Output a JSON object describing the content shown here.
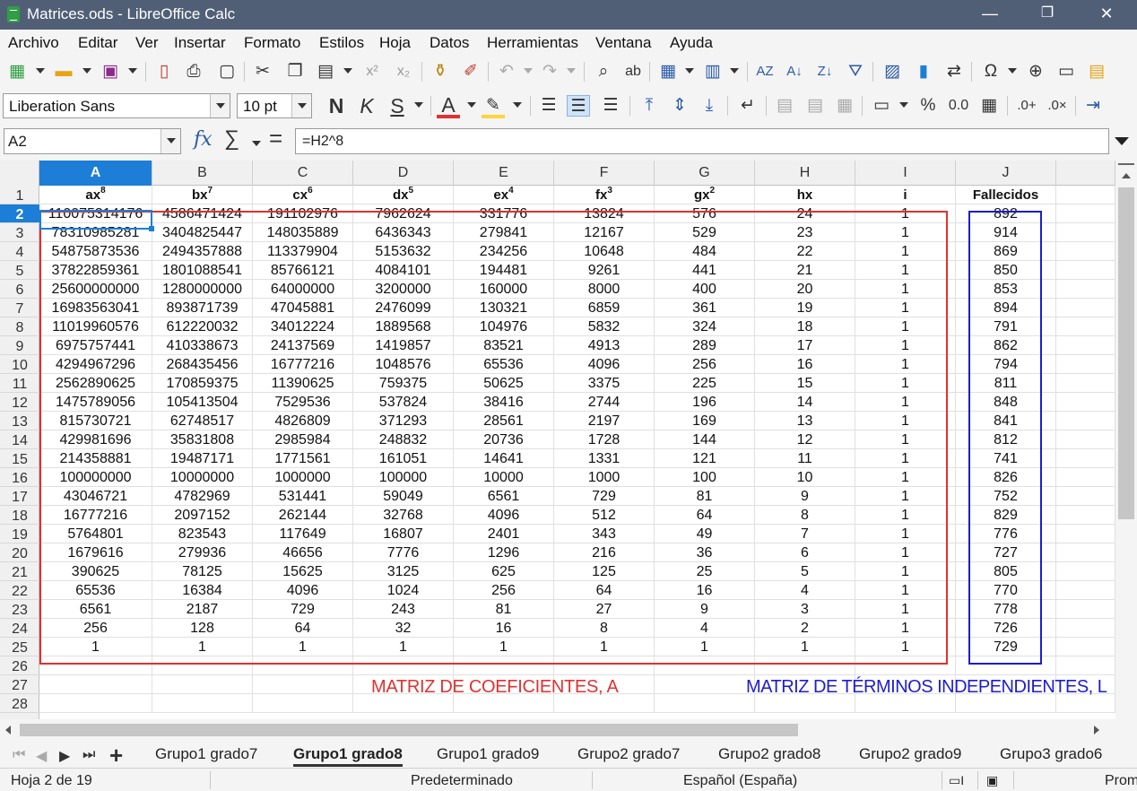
{
  "window": {
    "title": "Matrices.ods - LibreOffice Calc",
    "minimize": "—",
    "maximize": "❐",
    "close": "✕"
  },
  "menu": [
    "Archivo",
    "Editar",
    "Ver",
    "Insertar",
    "Formato",
    "Estilos",
    "Hoja",
    "Datos",
    "Herramientas",
    "Ventana",
    "Ayuda"
  ],
  "format_toolbar": {
    "font_name": "Liberation Sans",
    "font_size": "10 pt",
    "bold": "N",
    "italic": "K",
    "underline": "S",
    "font_color": "A",
    "percent": "%",
    "decimal": "0.0"
  },
  "formula_bar": {
    "name_box": "A2",
    "fx": "fx",
    "sigma": "∑",
    "equals": "=",
    "formula": "=H2^8"
  },
  "grid": {
    "columns": [
      "A",
      "B",
      "C",
      "D",
      "E",
      "F",
      "G",
      "H",
      "I",
      "J"
    ],
    "active_column": "A",
    "active_row": 2,
    "row_numbers": [
      1,
      2,
      3,
      4,
      5,
      6,
      7,
      8,
      9,
      10,
      11,
      12,
      13,
      14,
      15,
      16,
      17,
      18,
      19,
      20,
      21,
      22,
      23,
      24,
      25,
      26,
      27,
      28
    ],
    "headers": {
      "A": {
        "base": "ax",
        "sup": "8"
      },
      "B": {
        "base": "bx",
        "sup": "7"
      },
      "C": {
        "base": "cx",
        "sup": "6"
      },
      "D": {
        "base": "dx",
        "sup": "5"
      },
      "E": {
        "base": "ex",
        "sup": "4"
      },
      "F": {
        "base": "fx",
        "sup": "3"
      },
      "G": {
        "base": "gx",
        "sup": "2"
      },
      "H": {
        "base": "hx",
        "sup": ""
      },
      "I": {
        "base": "i",
        "sup": ""
      },
      "J": {
        "base": "Fallecidos",
        "sup": ""
      }
    },
    "rows": [
      [
        "110075314176",
        "4586471424",
        "191102976",
        "7962624",
        "331776",
        "13824",
        "576",
        "24",
        "1",
        "892"
      ],
      [
        "78310985281",
        "3404825447",
        "148035889",
        "6436343",
        "279841",
        "12167",
        "529",
        "23",
        "1",
        "914"
      ],
      [
        "54875873536",
        "2494357888",
        "113379904",
        "5153632",
        "234256",
        "10648",
        "484",
        "22",
        "1",
        "869"
      ],
      [
        "37822859361",
        "1801088541",
        "85766121",
        "4084101",
        "194481",
        "9261",
        "441",
        "21",
        "1",
        "850"
      ],
      [
        "25600000000",
        "1280000000",
        "64000000",
        "3200000",
        "160000",
        "8000",
        "400",
        "20",
        "1",
        "853"
      ],
      [
        "16983563041",
        "893871739",
        "47045881",
        "2476099",
        "130321",
        "6859",
        "361",
        "19",
        "1",
        "894"
      ],
      [
        "11019960576",
        "612220032",
        "34012224",
        "1889568",
        "104976",
        "5832",
        "324",
        "18",
        "1",
        "791"
      ],
      [
        "6975757441",
        "410338673",
        "24137569",
        "1419857",
        "83521",
        "4913",
        "289",
        "17",
        "1",
        "862"
      ],
      [
        "4294967296",
        "268435456",
        "16777216",
        "1048576",
        "65536",
        "4096",
        "256",
        "16",
        "1",
        "794"
      ],
      [
        "2562890625",
        "170859375",
        "11390625",
        "759375",
        "50625",
        "3375",
        "225",
        "15",
        "1",
        "811"
      ],
      [
        "1475789056",
        "105413504",
        "7529536",
        "537824",
        "38416",
        "2744",
        "196",
        "14",
        "1",
        "848"
      ],
      [
        "815730721",
        "62748517",
        "4826809",
        "371293",
        "28561",
        "2197",
        "169",
        "13",
        "1",
        "841"
      ],
      [
        "429981696",
        "35831808",
        "2985984",
        "248832",
        "20736",
        "1728",
        "144",
        "12",
        "1",
        "812"
      ],
      [
        "214358881",
        "19487171",
        "1771561",
        "161051",
        "14641",
        "1331",
        "121",
        "11",
        "1",
        "741"
      ],
      [
        "100000000",
        "10000000",
        "1000000",
        "100000",
        "10000",
        "1000",
        "100",
        "10",
        "1",
        "826"
      ],
      [
        "43046721",
        "4782969",
        "531441",
        "59049",
        "6561",
        "729",
        "81",
        "9",
        "1",
        "752"
      ],
      [
        "16777216",
        "2097152",
        "262144",
        "32768",
        "4096",
        "512",
        "64",
        "8",
        "1",
        "829"
      ],
      [
        "5764801",
        "823543",
        "117649",
        "16807",
        "2401",
        "343",
        "49",
        "7",
        "1",
        "776"
      ],
      [
        "1679616",
        "279936",
        "46656",
        "7776",
        "1296",
        "216",
        "36",
        "6",
        "1",
        "727"
      ],
      [
        "390625",
        "78125",
        "15625",
        "3125",
        "625",
        "125",
        "25",
        "5",
        "1",
        "805"
      ],
      [
        "65536",
        "16384",
        "4096",
        "1024",
        "256",
        "64",
        "16",
        "4",
        "1",
        "770"
      ],
      [
        "6561",
        "2187",
        "729",
        "243",
        "81",
        "27",
        "9",
        "3",
        "1",
        "778"
      ],
      [
        "256",
        "128",
        "64",
        "32",
        "16",
        "8",
        "4",
        "2",
        "1",
        "726"
      ],
      [
        "1",
        "1",
        "1",
        "1",
        "1",
        "1",
        "1",
        "1",
        "1",
        "729"
      ]
    ],
    "annotation_left": "MATRIZ DE COEFICIENTES, A",
    "annotation_right": "MATRIZ DE TÉRMINOS INDEPENDIENTES, L",
    "colors": {
      "selection": "#1c7ed6",
      "matrix_a_border": "#e03131",
      "matrix_l_border": "#1c1cd0"
    }
  },
  "sheet_tabs": {
    "add": "+",
    "tabs": [
      "Grupo1 grado7",
      "Grupo1 grado8",
      "Grupo1 grado9",
      "Grupo2 grado7",
      "Grupo2 grado8",
      "Grupo2 grado9",
      "Grupo3 grado6"
    ],
    "active": "Grupo1 grado8"
  },
  "status_bar": {
    "sheet": "Hoja 2 de 19",
    "page_style": "Predeterminado",
    "language": "Español (España)",
    "extra": "Prom"
  }
}
